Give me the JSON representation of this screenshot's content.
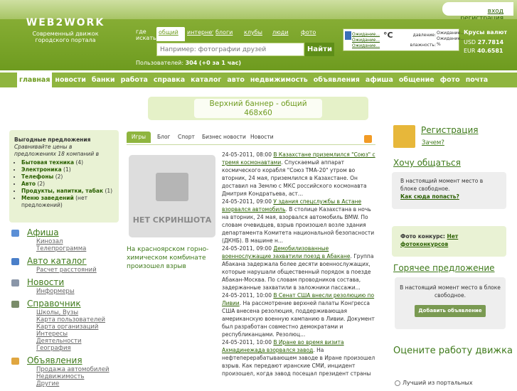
{
  "top": {
    "login": "вход",
    "register": "регистрация"
  },
  "logo": {
    "text": "WEB2WORK",
    "subtitle_line1": "Современный движок",
    "subtitle_line2": "городского портала"
  },
  "search": {
    "where_label_line1": "где",
    "where_label_line2": "искать:",
    "tabs": [
      "общий",
      "интернет",
      "блоги",
      "клубы",
      "люди",
      "фото"
    ],
    "active_tab": "общий",
    "placeholder": "Например: фотографии друзей",
    "button": "Найти"
  },
  "users": {
    "label": "Пользователей:",
    "count": "304",
    "delta": "(+0 за 1 час)"
  },
  "weather": {
    "loading1": "Ожидание...",
    "loading2": "Ожидание...",
    "loading3": "Ожидание...",
    "temp": "°C",
    "pressure_label": "давление:",
    "humidity_label": "влажность:",
    "pressure_val": "Ожидание...",
    "humidity_val": "Ожидание...",
    "percent": "%"
  },
  "rates": {
    "title": "Крусы валют",
    "usd_label": "USD",
    "usd": "27.7814",
    "eur_label": "EUR",
    "eur": "40.6581"
  },
  "nav": [
    "главная",
    "новости",
    "банки",
    "работа",
    "справка",
    "каталог",
    "авто",
    "недвижимость",
    "объявления",
    "афиша",
    "общение",
    "фото",
    "почта"
  ],
  "banner": {
    "line1": "Верхний баннер - общий",
    "line2": "468x60"
  },
  "offers": {
    "title": "Выгодные предложения",
    "intro": "Сравнивайте цены в предложениях 18 компаний в",
    "items": [
      {
        "name": "Бытовая техника",
        "count": "(4)"
      },
      {
        "name": "Электроника",
        "count": "(1)"
      },
      {
        "name": "Телефоны",
        "count": "(2)"
      },
      {
        "name": "Авто",
        "count": "(2)"
      },
      {
        "name": "Продукты, напитки, табак",
        "count": "(1)"
      },
      {
        "name": "Меню заведений",
        "count": "(нет предложений)"
      }
    ]
  },
  "categories": [
    {
      "title": "Афиша",
      "color": "#5b8fd6",
      "subs": [
        "Кинозал",
        "Телепрограмма"
      ]
    },
    {
      "title": "Авто каталог",
      "color": "#4a7fc9",
      "subs": [
        "Расчет расстояний"
      ]
    },
    {
      "title": "Новости",
      "color": "#8a96a8",
      "subs": [
        "Информеры"
      ]
    },
    {
      "title": "Справочник",
      "color": "#7a8c6a",
      "subs": [
        "Школы, Вузы",
        "Карта пользователей",
        "Карта организаций",
        "Интересы",
        "Деятельности",
        "География"
      ]
    },
    {
      "title": "Объявления",
      "color": "#e0a640",
      "subs": [
        "Продажа автомобилей",
        "Недвижимость",
        "Другие"
      ]
    }
  ],
  "tabs": [
    "Игры",
    "Блог",
    "Спорт",
    "Бизнес новости",
    "Новости"
  ],
  "noscreen": "НЕТ СКРИНШОТА",
  "caption": "На красноярском горно-химическом комбинате произошел взрыв",
  "news": [
    {
      "date": "24-05-2011, 08:00",
      "title": "В Казахстане приземлился \"Союз\" с тремя космонавтами",
      "text": ". Спускаемый аппарат космического корабля \"Союз ТМА-20\" утром во вторник, 24 мая, приземлился в Казахстане. Он доставил на Землю с МКС российского космонавта Дмитрия Кондратьева, аст..."
    },
    {
      "date": "24-05-2011, 09:00",
      "title": "У здания спецслужбы в Астане взорвался автомобиль",
      "text": ". В столице Казахстана в ночь на вторник, 24 мая, взорвался автомобиль BMW. По словам очевидцев, взрыв произошел возле здания департамента Комитета национальной безопасности (ДКНБ). В машине н..."
    },
    {
      "date": "24-05-2011, 09:00",
      "title": "Демобилизованные военнослужащие захватили поезд в Абакане",
      "text": ". Группа Абакана задержала более десяти военнослужащих, которые нарушали общественный порядок в поезде Абакан-Москва. По словам проводников состава, задержанные захватили в заложники пассажи..."
    },
    {
      "date": "24-05-2011, 10:00",
      "title": "В Сенат США внесли резолюцию по Ливии",
      "text": ". На рассмотрение верхней палаты Конгресса США внесена резолюция, поддерживающая американскую военную кампанию в Ливии. Документ был разработан совместно демократами и республиканцами. Резолюц..."
    },
    {
      "date": "24-05-2011, 10:00",
      "title": "В Иране во время визита Ахмадинежада взорвался завод",
      "text": ". На нефтеперерабатывающем заводе в Иране произошел взрыв. Как передают иранские СМИ, инцидент произошел, когда завод посещал президент страны"
    }
  ],
  "right": {
    "reg_title": "Регистрация",
    "reg_why": "Зачем?",
    "want": "Хочу общаться",
    "box1_text": "В настоящий момент место в блоке свободное.",
    "box1_link": "Как сюда попасть?",
    "photo_label": "Фото конкурс:",
    "photo_link": "Нет фотоконкурсов",
    "hot": "Горячее предложение",
    "box2_text": "В настоящий момент место в блоке свободное.",
    "box2_btn": "Добавить объявление",
    "rate": "Оцените работу движка",
    "poll_option": "Лучший из портальных"
  }
}
